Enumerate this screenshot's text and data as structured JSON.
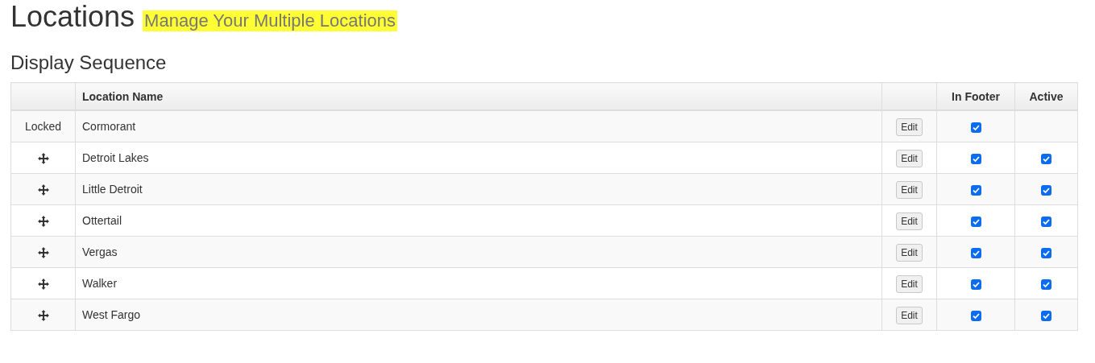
{
  "page_title": "Locations",
  "subtitle": "Manage Your Multiple Locations",
  "section_title": "Display Sequence",
  "table": {
    "columns": [
      "",
      "Location Name",
      "",
      "In Footer",
      "Active"
    ],
    "rows": [
      {
        "kind": "locked",
        "handle": "Locked",
        "name": "Cormorant",
        "edit": "Edit",
        "in_footer": true
      },
      {
        "kind": "draggable",
        "name": "Detroit Lakes",
        "edit": "Edit",
        "in_footer": true,
        "active": true
      },
      {
        "kind": "draggable",
        "name": "Little Detroit",
        "edit": "Edit",
        "in_footer": true,
        "active": true
      },
      {
        "kind": "draggable",
        "name": "Ottertail",
        "edit": "Edit",
        "in_footer": true,
        "active": true
      },
      {
        "kind": "draggable",
        "name": "Vergas",
        "edit": "Edit",
        "in_footer": true,
        "active": true
      },
      {
        "kind": "draggable",
        "name": "Walker",
        "edit": "Edit",
        "in_footer": true,
        "active": true
      },
      {
        "kind": "draggable",
        "name": "West Fargo",
        "edit": "Edit",
        "in_footer": true,
        "active": true
      }
    ]
  }
}
